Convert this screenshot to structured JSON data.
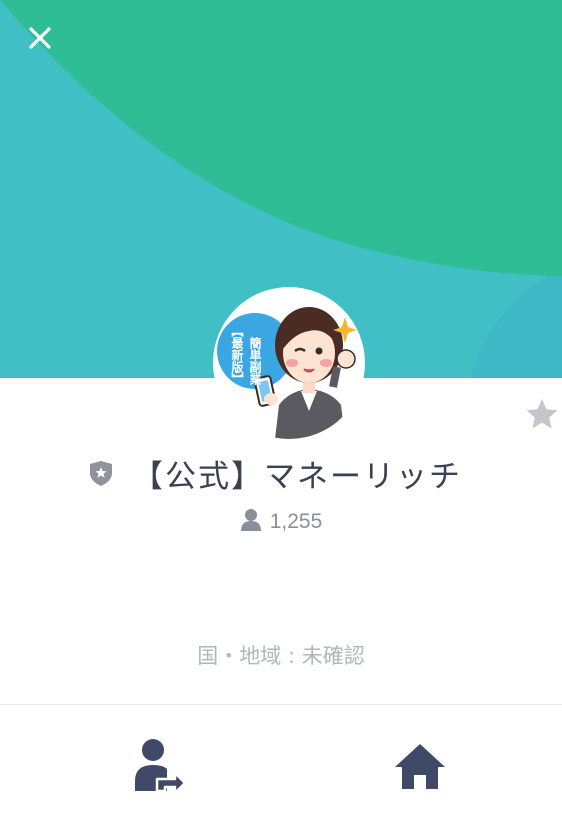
{
  "profile": {
    "name": "【公式】マネーリッチ",
    "friends_count": "1,255",
    "region": "国・地域 : 未確認",
    "avatar_badge_top": "簡単副業",
    "avatar_badge_bottom": "【最新版】"
  },
  "icons": {
    "close": "close-icon",
    "favorite": "star-icon",
    "official": "shield-star-icon",
    "friends": "person-icon",
    "share": "share-profile-icon",
    "home": "home-icon"
  },
  "colors": {
    "header_teal": "#40c0c4",
    "header_green": "#2fbd96",
    "text_dark": "#3a4150",
    "text_gray": "#8a8f99",
    "icon_navy": "#3f4a68"
  }
}
